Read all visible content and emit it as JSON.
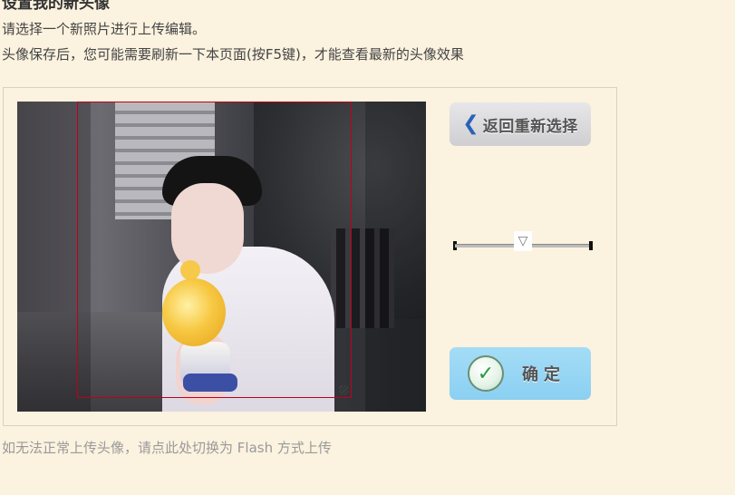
{
  "page": {
    "title": "设置我的新头像",
    "instruction1": "请选择一个新照片进行上传编辑。",
    "instruction2": "头像保存后，您可能需要刷新一下本页面(按F5键)，才能查看最新的头像效果"
  },
  "editor": {
    "back_label": "返回重新选择",
    "back_icon": "chevron-left-icon",
    "confirm_label": "确定",
    "confirm_icon": "check-circle-icon",
    "slider_thumb_glyph": "▽",
    "accent_color": "#2a63b8",
    "crop_border_color": "#c0001a",
    "confirm_bg_color": "#a4dcf6"
  },
  "footer": {
    "flash_link": "如无法正常上传头像，请点此处切换为 Flash 方式上传"
  }
}
